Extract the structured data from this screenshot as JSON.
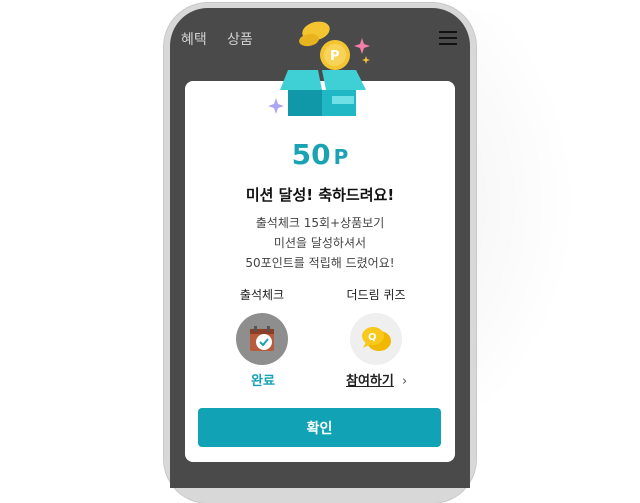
{
  "header": {
    "tabs": [
      {
        "label": "혜택"
      },
      {
        "label": "상품"
      }
    ]
  },
  "modal": {
    "points_value": "50",
    "points_unit": "P",
    "title": "미션 달성! 축하드려요!",
    "description_lines": [
      "출석체크 15회+상품보기",
      "미션을 달성하셔서",
      "50포인트를 적립해 드렸어요!"
    ],
    "missions": [
      {
        "label": "출석체크",
        "status": "완료",
        "icon": "calendar-check-icon"
      },
      {
        "label": "더드림 퀴즈",
        "status": "참여하기",
        "status_arrow": "›",
        "icon": "quiz-bubble-icon"
      }
    ],
    "confirm_label": "확인"
  },
  "colors": {
    "accent": "#12a2b5",
    "dim_overlay": "#4a4a4a",
    "coin": "#f5c531"
  }
}
